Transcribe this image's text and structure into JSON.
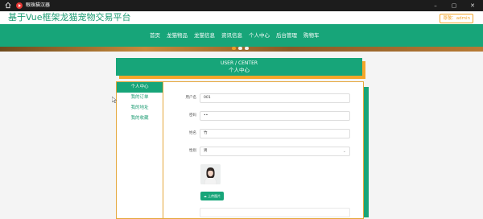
{
  "window": {
    "app_name": "眼珠猫汉器"
  },
  "header": {
    "site_title": "基于Vue框架龙猫宠物交易平台",
    "user_badge": "尊敬：admin"
  },
  "nav": {
    "items": [
      "首页",
      "龙猫物品",
      "龙猫信息",
      "资讯信息",
      "个人中心",
      "后台管理",
      "购物车"
    ]
  },
  "center": {
    "title_en": "USER / CENTER",
    "title_cn": "个人中心"
  },
  "sidebar": {
    "items": [
      "个人中心",
      "我的订单",
      "我的地址",
      "我的收藏"
    ]
  },
  "form": {
    "username_label": "用户名",
    "username_value": "001",
    "password_label": "密码",
    "password_value": "••",
    "name_label": "姓名",
    "name_value": "竹",
    "gender_label": "性别",
    "gender_value": "男",
    "upload_label": "上传图片"
  },
  "colors": {
    "primary": "#17a579",
    "accent": "#f4a62a",
    "titlebar": "#1c1c1c"
  }
}
